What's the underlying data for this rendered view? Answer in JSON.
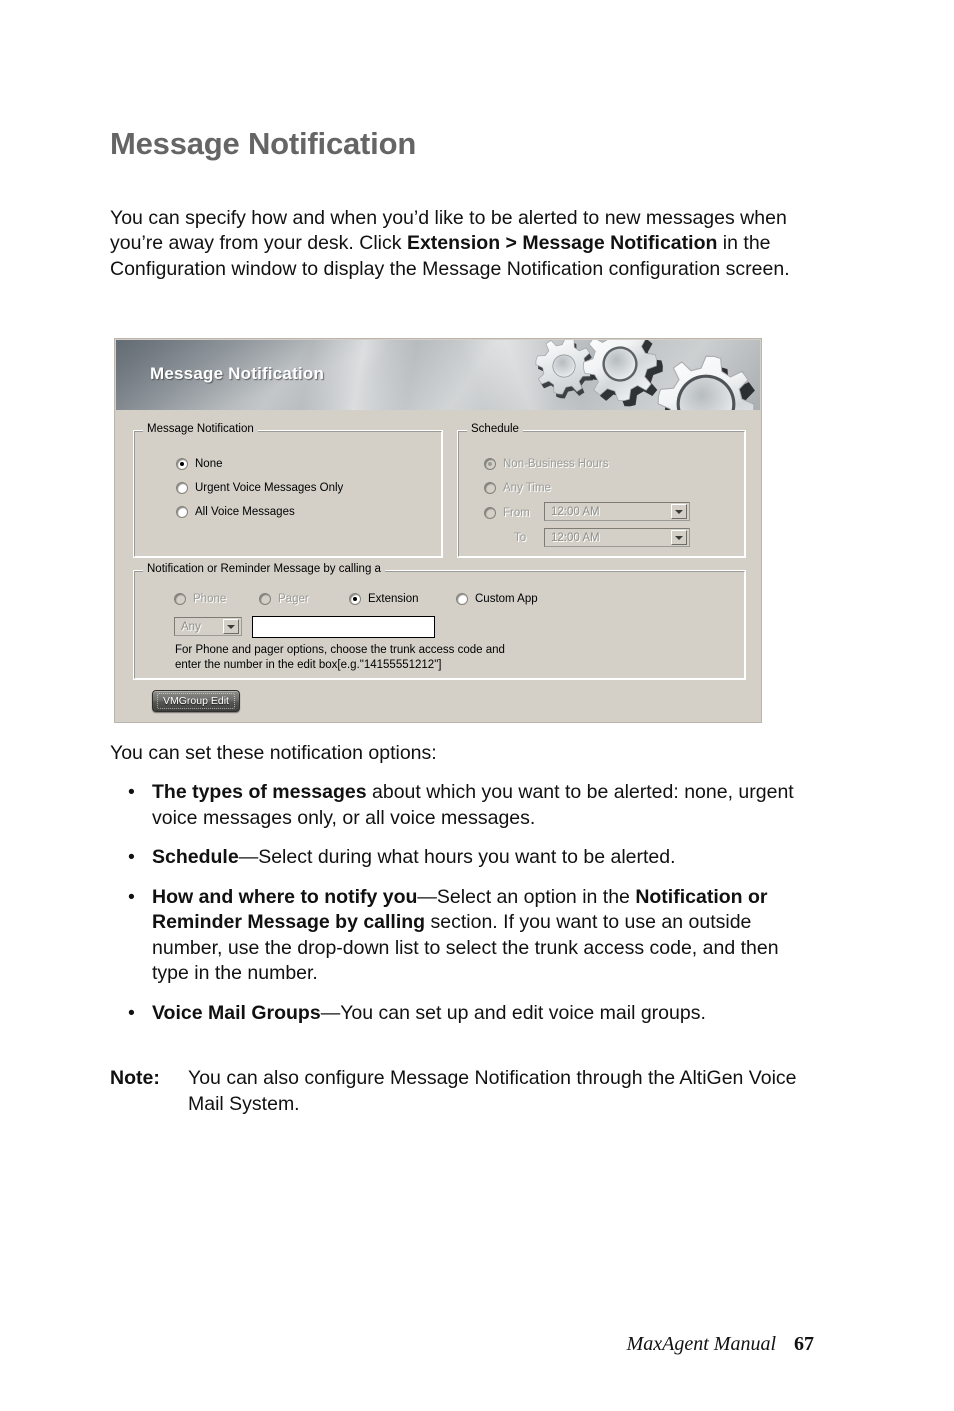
{
  "page": {
    "title": "Message Notification",
    "intro_before_bold": "You can specify how and when you’d like to be alerted to new messages when you’re away from your desk. Click ",
    "intro_bold_1": "Extension > Message Notification",
    "intro_after_bold": " in the Configuration window to display the Message Notification configuration screen.",
    "lead": "You can set these notification options:",
    "bullet_char": "•"
  },
  "dialog": {
    "banner_title": "Message Notification",
    "groups": {
      "message_notification": {
        "legend": "Message Notification",
        "options": [
          {
            "label": "None",
            "checked": true,
            "disabled": false
          },
          {
            "label": "Urgent Voice Messages Only",
            "checked": false,
            "disabled": false
          },
          {
            "label": "All Voice Messages",
            "checked": false,
            "disabled": false
          }
        ]
      },
      "schedule": {
        "legend": "Schedule",
        "options": [
          {
            "label": "Non-Business Hours",
            "checked": true,
            "disabled": true
          },
          {
            "label": "Any Time",
            "checked": false,
            "disabled": true
          },
          {
            "label": "From",
            "checked": false,
            "disabled": true
          }
        ],
        "to_label": "To",
        "from_time": "12:00 AM",
        "to_time": "12:00 AM"
      },
      "notification_method": {
        "legend": "Notification or Reminder Message  by calling a",
        "options": [
          {
            "label": "Phone",
            "checked": false,
            "disabled": true
          },
          {
            "label": "Pager",
            "checked": false,
            "disabled": true
          },
          {
            "label": "Extension",
            "checked": true,
            "disabled": false
          },
          {
            "label": "Custom App",
            "checked": false,
            "disabled": false
          }
        ],
        "trunk_combo_value": "Any",
        "number_field_value": "",
        "hint": "For Phone and pager options, choose the trunk access code and\nenter the number in the edit box[e.g.\"14155551212\"]"
      }
    },
    "vmgroup_button": "VMGroup Edit"
  },
  "bullets": [
    {
      "bold": "The types of messages",
      "rest": " about which you want to be alerted: none, urgent voice messages only, or all voice messages."
    },
    {
      "bold": "Schedule",
      "rest": "—Select during what hours you want to be alerted."
    },
    {
      "bold": "How and where to notify you",
      "rest": "—Select an option in the ",
      "bold2": "Notification or Reminder Message by calling",
      "rest2": " section. If you want to use an outside number, use the drop-down list to select the trunk access code, and then type in the number."
    },
    {
      "bold": "Voice Mail Groups",
      "rest": "—You can set up and edit voice mail groups."
    }
  ],
  "note": {
    "label": "Note:",
    "text": "You can also configure Message Notification through the AltiGen Voice Mail System."
  },
  "footer": {
    "book": "MaxAgent Manual",
    "page_number": "67"
  },
  "colors": {
    "heading": "#656565",
    "dialog_face": "#d4d0c8",
    "disabled_text": "#9b9b97"
  }
}
